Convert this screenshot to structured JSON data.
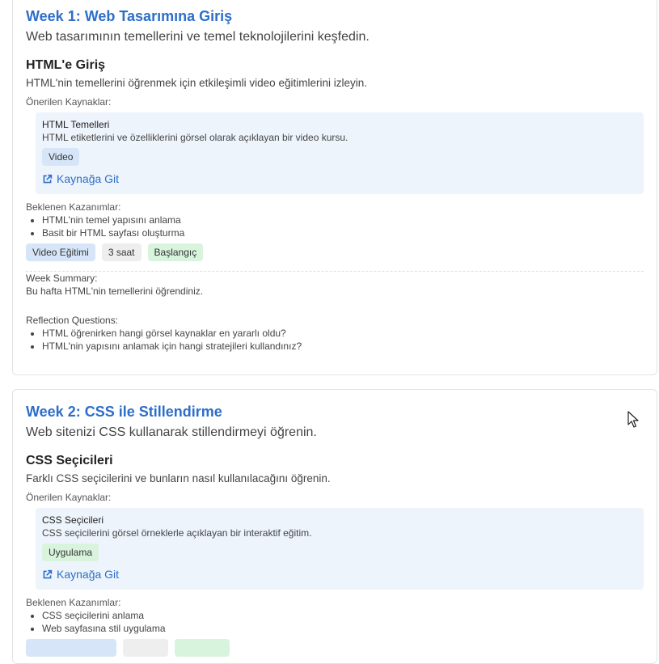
{
  "weeks": [
    {
      "title": "Week 1: Web Tasarımına Giriş",
      "description": "Web tasarımının temellerini ve temel teknolojilerini keşfedin.",
      "lesson": {
        "title": "HTML'e Giriş",
        "description": "HTML'nin temellerini öğrenmek için etkileşimli video eğitimlerini izleyin.",
        "resources_label": "Önerilen Kaynaklar:",
        "resource": {
          "title": "HTML Temelleri",
          "description": "HTML etiketlerini ve özelliklerini görsel olarak açıklayan bir video kursu.",
          "type": "Video",
          "link_label": "Kaynağa Git"
        },
        "outcomes_label": "Beklenen Kazanımlar:",
        "outcomes": [
          "HTML'nin temel yapısını anlama",
          "Basit bir HTML sayfası oluşturma"
        ],
        "tags": [
          "Video Eğitimi",
          "3 saat",
          "Başlangıç"
        ]
      },
      "summary_label": "Week Summary:",
      "summary": "Bu hafta HTML'nin temellerini öğrendiniz.",
      "reflection_label": "Reflection Questions:",
      "reflection": [
        "HTML öğrenirken hangi görsel kaynaklar en yararlı oldu?",
        "HTML'nin yapısını anlamak için hangi stratejileri kullandınız?"
      ]
    },
    {
      "title": "Week 2: CSS ile Stillendirme",
      "description": "Web sitenizi CSS kullanarak stillendirmeyi öğrenin.",
      "lesson": {
        "title": "CSS Seçicileri",
        "description": "Farklı CSS seçicilerini ve bunların nasıl kullanılacağını öğrenin.",
        "resources_label": "Önerilen Kaynaklar:",
        "resource": {
          "title": "CSS Seçicileri",
          "description": "CSS seçicilerini görsel örneklerle açıklayan bir interaktif eğitim.",
          "type": "Uygulama",
          "link_label": "Kaynağa Git"
        },
        "outcomes_label": "Beklenen Kazanımlar:",
        "outcomes": [
          "CSS seçicilerini anlama",
          "Web sayfasına stil uygulama"
        ]
      }
    }
  ],
  "colors": {
    "accent": "#2d6ec9",
    "resource_bg": "#eef4fb",
    "tag_blue": "#d6e6f8",
    "tag_green": "#d9f4dd",
    "tag_gray": "#eeeeee"
  },
  "icons": {
    "link": "external-link-icon",
    "cursor": "mouse-cursor-icon"
  }
}
